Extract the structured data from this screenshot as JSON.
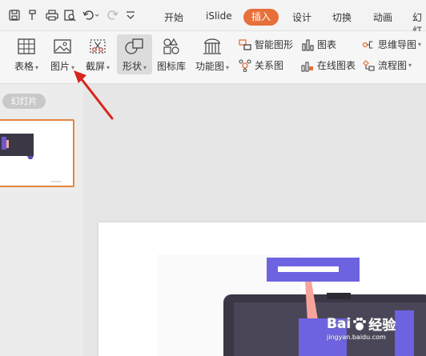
{
  "colors": {
    "accent": "#e76f3a",
    "selection": "#e2843f",
    "arrow": "#d9251e"
  },
  "menu": {
    "tabs": [
      "开始",
      "iSlide",
      "插入",
      "设计",
      "切换",
      "动画",
      "幻灯"
    ],
    "active": "插入"
  },
  "ribbon": {
    "table": "表格",
    "picture": "图片",
    "screenshot": "截屏",
    "shape": "形状",
    "icon_lib": "图标库",
    "function_chart": "功能图",
    "smart_graphic": "智能图形",
    "relation_chart": "关系图",
    "icons": "图表",
    "online_chart": "在线图表",
    "mindmap": "思维导图",
    "flowchart": "流程图"
  },
  "sidebar": {
    "tab_label": "幻灯片"
  },
  "watermark": {
    "brand": "Bai",
    "brand2": "经验",
    "url": "jingyan.baidu.com"
  }
}
